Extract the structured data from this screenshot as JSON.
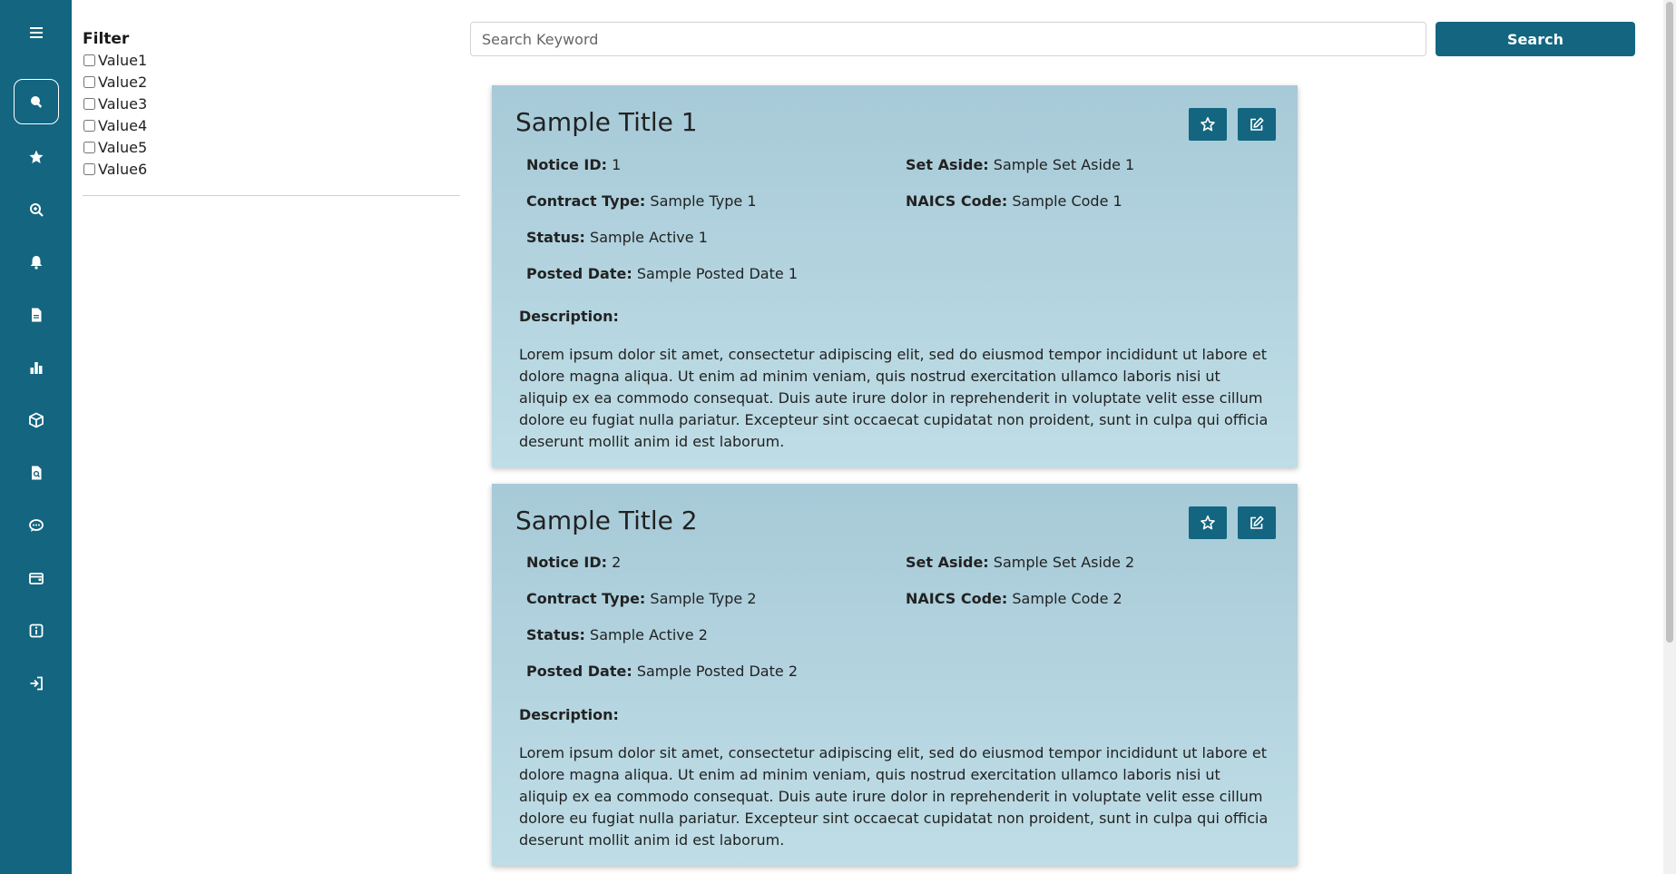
{
  "sidebar": {
    "items": [
      {
        "icon": "menu-icon"
      },
      {
        "icon": "search-icon",
        "active": true
      },
      {
        "icon": "star-icon"
      },
      {
        "icon": "search-plus-icon"
      },
      {
        "icon": "bell-icon"
      },
      {
        "icon": "document-icon"
      },
      {
        "icon": "bar-chart-icon"
      },
      {
        "icon": "cube-icon"
      },
      {
        "icon": "file-search-icon"
      },
      {
        "icon": "chat-icon"
      },
      {
        "icon": "wallet-icon"
      },
      {
        "icon": "info-icon"
      },
      {
        "icon": "sign-out-icon"
      }
    ]
  },
  "filter": {
    "title": "Filter",
    "options": [
      "Value1",
      "Value2",
      "Value3",
      "Value4",
      "Value5",
      "Value6"
    ]
  },
  "search": {
    "placeholder": "Search Keyword",
    "button_label": "Search"
  },
  "cards": [
    {
      "title": "Sample Title 1",
      "notice_id_label": "Notice ID:",
      "notice_id": "1",
      "set_aside_label": "Set Aside:",
      "set_aside": "Sample Set Aside 1",
      "contract_type_label": "Contract Type:",
      "contract_type": "Sample Type 1",
      "naics_label": "NAICS Code:",
      "naics": "Sample Code 1",
      "status_label": "Status:",
      "status": "Sample Active 1",
      "posted_date_label": "Posted Date:",
      "posted_date": "Sample Posted Date 1",
      "description_label": "Description:",
      "description": "Lorem ipsum dolor sit amet, consectetur adipiscing elit, sed do eiusmod tempor incididunt ut labore et dolore magna aliqua. Ut enim ad minim veniam, quis nostrud exercitation ullamco laboris nisi ut aliquip ex ea commodo consequat. Duis aute irure dolor in reprehenderit in voluptate velit esse cillum dolore eu fugiat nulla pariatur. Excepteur sint occaecat cupidatat non proident, sunt in culpa qui officia deserunt mollit anim id est laborum."
    },
    {
      "title": "Sample Title 2",
      "notice_id_label": "Notice ID:",
      "notice_id": "2",
      "set_aside_label": "Set Aside:",
      "set_aside": "Sample Set Aside 2",
      "contract_type_label": "Contract Type:",
      "contract_type": "Sample Type 2",
      "naics_label": "NAICS Code:",
      "naics": "Sample Code 2",
      "status_label": "Status:",
      "status": "Sample Active 2",
      "posted_date_label": "Posted Date:",
      "posted_date": "Sample Posted Date 2",
      "description_label": "Description:",
      "description": "Lorem ipsum dolor sit amet, consectetur adipiscing elit, sed do eiusmod tempor incididunt ut labore et dolore magna aliqua. Ut enim ad minim veniam, quis nostrud exercitation ullamco laboris nisi ut aliquip ex ea commodo consequat. Duis aute irure dolor in reprehenderit in voluptate velit esse cillum dolore eu fugiat nulla pariatur. Excepteur sint occaecat cupidatat non proident, sunt in culpa qui officia deserunt mollit anim id est laborum."
    }
  ],
  "colors": {
    "brand": "#136580",
    "card_bg": "#b3d3df"
  }
}
